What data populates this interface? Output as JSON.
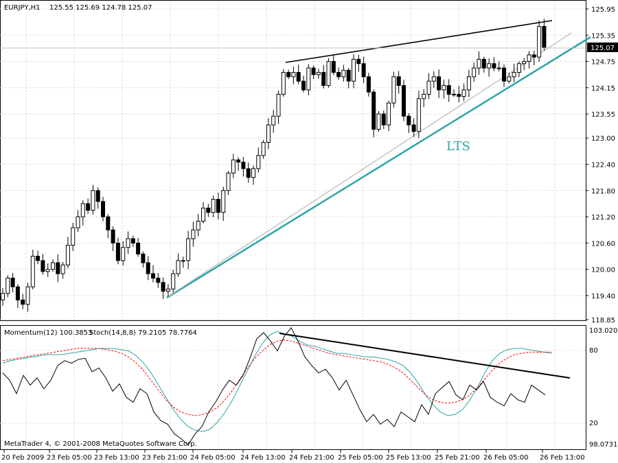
{
  "header": {
    "symbol": "EURJPY,H1",
    "ohlc": "125.55 125.69 124.78 125.07"
  },
  "price_axis": {
    "ticks": [
      "125.95",
      "125.35",
      "124.75",
      "124.15",
      "123.55",
      "123.00",
      "122.40",
      "121.80",
      "121.20",
      "120.60",
      "120.00",
      "119.40",
      "118.85"
    ],
    "current_price": "125.07"
  },
  "annotation": {
    "text": "LTS"
  },
  "indicator_header": {
    "momentum": "Momentum(12) 100.3853",
    "stoch": "Stoch(14,8,8) 79.2105 78.7764"
  },
  "indicator_axis": {
    "ticks": [
      "103.0203",
      "80",
      "20",
      "98.0731"
    ]
  },
  "copyright": "MetaTrader 4, © 2001-2008 MetaQuotes Software Corp.",
  "time_axis": {
    "ticks": [
      "20 Feb 2009",
      "23 Feb 05:00",
      "23 Feb 13:00",
      "23 Feb 21:00",
      "24 Feb 05:00",
      "24 Feb 13:00",
      "24 Feb 21:00",
      "25 Feb 05:00",
      "25 Feb 13:00",
      "25 Feb 21:00",
      "26 Feb 05:00",
      "26 Feb 13:00"
    ]
  },
  "colors": {
    "lts_line": "#2aa5a5",
    "channel_line": "#c0c0c0",
    "resistance_line": "#000000",
    "momentum": "#000000",
    "stoch_main": "#2aa5a5",
    "stoch_signal": "#ff0000"
  },
  "chart_data": [
    {
      "type": "candlestick",
      "ylim": [
        118.85,
        125.95
      ],
      "candles_close": [
        119.45,
        119.8,
        119.6,
        119.3,
        119.2,
        119.6,
        120.3,
        120.2,
        119.95,
        120.0,
        120.15,
        119.9,
        120.1,
        120.55,
        120.95,
        121.2,
        121.5,
        121.35,
        121.8,
        121.55,
        121.2,
        120.9,
        120.6,
        120.2,
        120.5,
        120.7,
        120.6,
        120.35,
        120.15,
        119.9,
        119.8,
        119.7,
        119.5,
        119.55,
        119.9,
        120.2,
        120.2,
        120.7,
        120.9,
        121.1,
        121.4,
        121.3,
        121.6,
        121.3,
        121.8,
        122.2,
        122.5,
        122.45,
        122.3,
        122.1,
        122.3,
        122.6,
        122.9,
        123.3,
        123.5,
        124.0,
        124.5,
        124.4,
        124.5,
        124.3,
        124.1,
        124.6,
        124.45,
        124.5,
        124.2,
        124.75,
        124.5,
        124.4,
        124.55,
        124.3,
        124.8,
        124.7,
        124.4,
        124.05,
        123.2,
        123.55,
        123.3,
        123.8,
        124.4,
        124.2,
        123.5,
        123.3,
        123.15,
        123.9,
        124.0,
        124.3,
        124.4,
        124.1,
        124.2,
        124.0,
        124.0,
        123.95,
        124.1,
        124.4,
        124.6,
        124.8,
        124.6,
        124.7,
        124.6,
        124.6,
        124.3,
        124.4,
        124.5,
        124.7,
        124.75,
        124.9,
        124.85,
        125.55,
        125.07
      ],
      "price_labels": [
        "125.95",
        "125.35",
        "124.75",
        "124.15",
        "123.55",
        "123.00",
        "122.40",
        "121.80",
        "121.20",
        "120.60",
        "120.00",
        "119.40",
        "118.85"
      ]
    },
    {
      "type": "line",
      "ylim": [
        0,
        100
      ],
      "series": [
        {
          "name": "Momentum(12) 100.3853"
        },
        {
          "name": "Stoch(14,8,8) 79.2105"
        },
        {
          "name": "78.7764"
        }
      ]
    }
  ]
}
